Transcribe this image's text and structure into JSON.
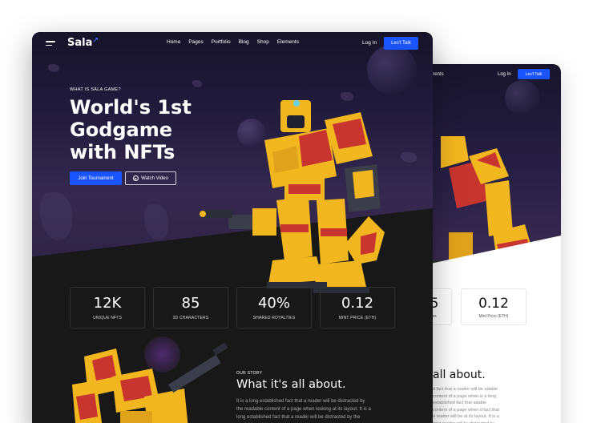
{
  "colors": {
    "accent": "#1a54ff",
    "dark_bg": "#181818",
    "robot_yellow": "#f2b61f",
    "robot_red": "#c8352f"
  },
  "front": {
    "nav": {
      "logo": "Sala",
      "links": [
        "Home",
        "Pages",
        "Portfolio",
        "Blog",
        "Shop",
        "Elements"
      ],
      "login": "Log In",
      "cta": "Les't Talk"
    },
    "hero": {
      "eyebrow": "WHAT IS SALA GAME?",
      "title_lines": [
        "World's 1st",
        "Godgame",
        "with NFTs"
      ],
      "join_button": "Join Tournament",
      "watch_button": "Watch Video"
    },
    "stats": [
      {
        "value": "12K",
        "label": "UNIQUE NFTS"
      },
      {
        "value": "85",
        "label": "3D CHARACTERS"
      },
      {
        "value": "40%",
        "label": "SHARED ROYALTIES"
      },
      {
        "value": "0.12",
        "label": "MINT PRICE (ETH)"
      }
    ],
    "story": {
      "eyebrow": "OUR STORY",
      "title": "What it's all about.",
      "paragraph": "It is a long established fact that a reader will be distracted by the readable content of a page when looking at its layout. It is a long established fact that a reader will be distracted by the readable content"
    }
  },
  "back": {
    "nav_fragment": "ements",
    "login": "Log In",
    "cta": "Les't Talk",
    "stats": [
      {
        "value": "5",
        "label": "es"
      },
      {
        "value": "0.12",
        "label": "Mint Price (ETH)"
      }
    ],
    "title": "all about.",
    "paragraph": "d fact that a reader will be adable content of a page when is a long established fact that adable content of a page when d fact that a reader will be at its layout. It is a long reader will be distracted by"
  }
}
